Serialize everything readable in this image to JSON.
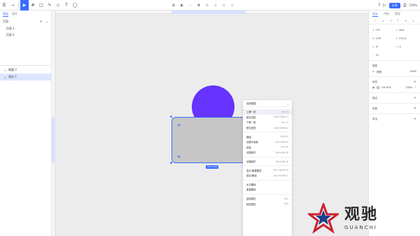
{
  "toolbar": {
    "tools": [
      {
        "name": "menu-icon",
        "glyph": "☰"
      },
      {
        "name": "move-icon",
        "glyph": "⇢"
      },
      {
        "name": "select-icon",
        "glyph": "▶"
      },
      {
        "name": "frame-icon",
        "glyph": "#"
      },
      {
        "name": "rectangle-icon",
        "glyph": "□"
      },
      {
        "name": "pen-icon",
        "glyph": "✎"
      },
      {
        "name": "shape-icon",
        "glyph": "◇"
      },
      {
        "name": "text-icon",
        "glyph": "T"
      },
      {
        "name": "comment-icon",
        "glyph": "◯"
      }
    ],
    "center_tools": [
      {
        "name": "component-icon",
        "glyph": "⊞",
        "dim": false
      },
      {
        "name": "mask-icon",
        "glyph": "◐",
        "dim": false
      },
      {
        "name": "boolean-icon",
        "glyph": "◇",
        "dim": true
      },
      {
        "name": "plugin-icon",
        "glyph": "✚",
        "dim": false
      },
      {
        "name": "union-icon",
        "glyph": "⧉",
        "dim": true
      },
      {
        "name": "subtract-icon",
        "glyph": "⧈",
        "dim": true
      },
      {
        "name": "intersect-icon",
        "glyph": "⧇",
        "dim": true
      },
      {
        "name": "exclude-icon",
        "glyph": "⧆",
        "dim": true
      }
    ],
    "right": {
      "help_icon": "?",
      "play_icon": "▷",
      "share_label": "分享",
      "export_icon": "⎙",
      "zoom": "100%"
    }
  },
  "left_panel": {
    "tabs": [
      "图层",
      "组件"
    ],
    "pages_label": "页面",
    "pages": [
      "页面 1",
      "页面 2"
    ],
    "layers": [
      {
        "name": "椭圆 2",
        "selected": false
      },
      {
        "name": "矩形 1",
        "selected": true
      }
    ]
  },
  "canvas": {
    "size_badge": "216×129"
  },
  "context_menu": {
    "header": "选择图层",
    "groups": [
      [
        {
          "label": "上移一层",
          "shortcut": "Ctrl+]",
          "hover": true
        },
        {
          "label": "移至顶层",
          "shortcut": "Ctrl+Shift+]",
          "hover": false
        },
        {
          "label": "下移一层",
          "shortcut": "Ctrl+[",
          "hover": false
        },
        {
          "label": "移至底层",
          "shortcut": "Ctrl+Shift+[",
          "hover": false
        }
      ],
      [
        {
          "label": "编组",
          "shortcut": "Ctrl+G",
          "hover": false
        },
        {
          "label": "创建为画板",
          "shortcut": "Ctrl+Alt+G",
          "hover": false
        },
        {
          "label": "蒙版",
          "shortcut": "Ctrl+E",
          "hover": false
        },
        {
          "label": "创建组件",
          "shortcut": "Ctrl+Alt+K",
          "hover": false
        }
      ],
      [
        {
          "label": "创建组件",
          "shortcut": "Ctrl+Alt+K",
          "hover": false
        }
      ],
      [
        {
          "label": "显示/隐藏图层",
          "shortcut": "Ctrl+Shift+H",
          "hover": false
        },
        {
          "label": "锁定/解锁",
          "shortcut": "Ctrl+Shift+L",
          "hover": false
        }
      ],
      [
        {
          "label": "水平翻转",
          "shortcut": "",
          "hover": false
        },
        {
          "label": "垂直翻转",
          "shortcut": "",
          "hover": false
        }
      ],
      [
        {
          "label": "复制属性",
          "shortcut": "Ctrl",
          "hover": false
        },
        {
          "label": "粘贴属性",
          "shortcut": "Ctrl",
          "hover": false
        }
      ]
    ]
  },
  "right_panel": {
    "tabs": [
      "设计",
      "代码",
      "原型"
    ],
    "props": [
      {
        "key": "X",
        "value": "170"
      },
      {
        "key": "Y",
        "value": "28.6"
      },
      {
        "key": "W",
        "value": "376"
      },
      {
        "key": "H",
        "value": "212.6"
      },
      {
        "key": "∠",
        "value": "0°"
      },
      {
        "key": "◔",
        "value": "0"
      },
      {
        "key": "⌐",
        "value": "21"
      },
      {
        "key": "",
        "value": ""
      }
    ],
    "layer_section": {
      "title": "图层",
      "blend": "穿透",
      "opacity": "100%"
    },
    "fill_section": {
      "title": "填充",
      "color": "C4C4C4",
      "opacity": "100%"
    },
    "stroke_section": {
      "title": "描边"
    },
    "shadow_section": {
      "title": "投影"
    },
    "export_section": {
      "title": "导出"
    }
  },
  "watermark": {
    "text": "观驰",
    "sub": "GUANCHI"
  }
}
